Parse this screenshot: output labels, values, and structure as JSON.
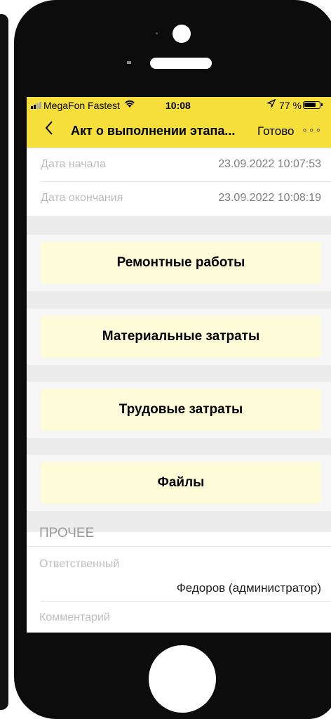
{
  "status_bar": {
    "carrier": "MegaFon Fastest",
    "time": "10:08",
    "battery": "77 %"
  },
  "nav": {
    "title": "Акт о выполнении этапа...",
    "done_label": "Готово",
    "more_label": "∘∘∘"
  },
  "fields": {
    "start_label": "Дата начала",
    "start_value": "23.09.2022 10:07:53",
    "end_label": "Дата окончания",
    "end_value": "23.09.2022 10:08:19"
  },
  "buttons": {
    "repair": "Ремонтные работы",
    "material": "Материальные затраты",
    "labor": "Трудовые затраты",
    "files": "Файлы"
  },
  "other": {
    "section_title": "ПРОЧЕЕ",
    "responsible_label": "Ответственный",
    "responsible_value": "Федоров (администратор)",
    "comment_label": "Комментарий"
  },
  "colors": {
    "accent": "#f7df3b",
    "button_bg": "#fefcd8"
  },
  "icons": [
    "back-chevron-icon",
    "wifi-icon",
    "location-arrow-icon",
    "battery-icon",
    "more-icon"
  ]
}
